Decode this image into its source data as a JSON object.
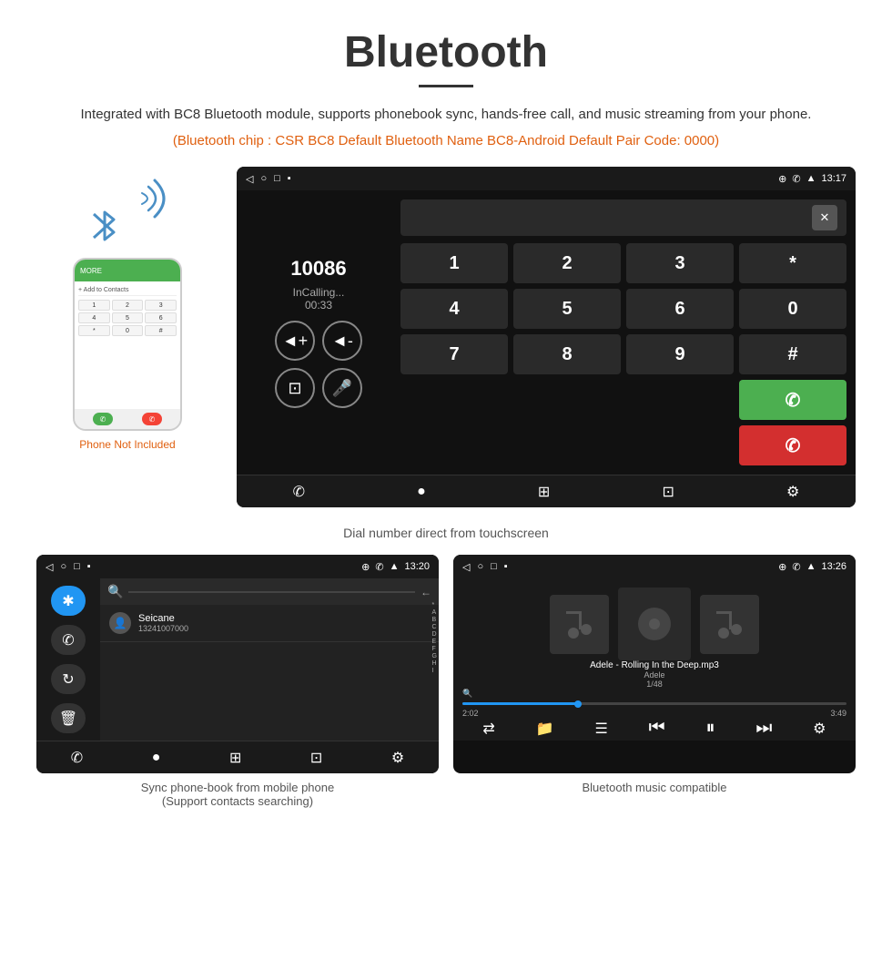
{
  "page": {
    "title": "Bluetooth",
    "subtitle": "Integrated with BC8 Bluetooth module, supports phonebook sync, hands-free call, and music streaming from your phone.",
    "orange_note": "(Bluetooth chip : CSR BC8    Default Bluetooth Name BC8-Android    Default Pair Code: 0000)",
    "phone_not_included": "Phone Not Included",
    "caption_dial": "Dial number direct from touchscreen",
    "caption_phonebook": "Sync phone-book from mobile phone\n(Support contacts searching)",
    "caption_music": "Bluetooth music compatible",
    "dial_screen": {
      "time": "13:17",
      "number": "10086",
      "status": "InCalling...",
      "timer": "00:33",
      "keys": [
        "1",
        "2",
        "3",
        "*",
        "4",
        "5",
        "6",
        "0",
        "7",
        "8",
        "9",
        "#"
      ]
    },
    "phonebook_screen": {
      "time": "13:20",
      "contact_name": "Seicane",
      "contact_phone": "13241007000",
      "alphabet": [
        "*",
        "A",
        "B",
        "C",
        "D",
        "E",
        "F",
        "G",
        "H",
        "I"
      ]
    },
    "music_screen": {
      "time": "13:26",
      "song_title": "Adele - Rolling In the Deep.mp3",
      "artist": "Adele",
      "track_count": "1/48",
      "current_time": "2:02",
      "total_time": "3:49",
      "progress_percent": 30
    }
  }
}
